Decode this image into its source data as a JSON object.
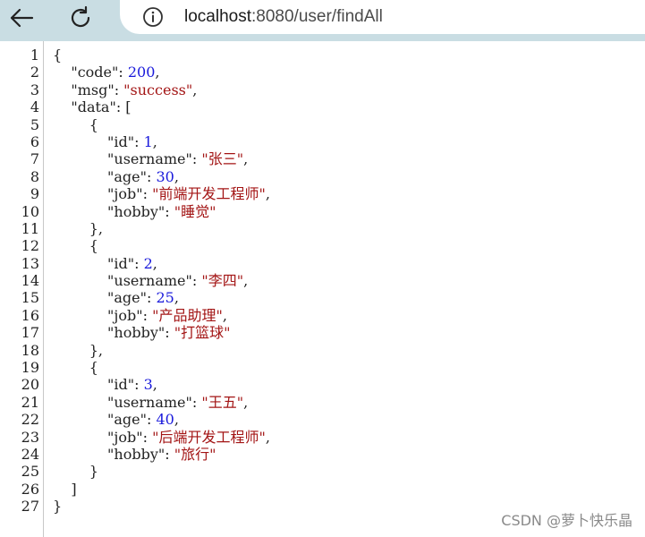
{
  "browser": {
    "url_host": "localhost",
    "url_rest": ":8080/user/findAll",
    "back_icon": "back-arrow-icon",
    "refresh_icon": "refresh-icon",
    "info_icon": "info-icon"
  },
  "response": {
    "code": 200,
    "msg": "success",
    "data": [
      {
        "id": 1,
        "username": "张三",
        "age": 30,
        "job": "前端开发工程师",
        "hobby": "睡觉"
      },
      {
        "id": 2,
        "username": "李四",
        "age": 25,
        "job": "产品助理",
        "hobby": "打篮球"
      },
      {
        "id": 3,
        "username": "王五",
        "age": 40,
        "job": "后端开发工程师",
        "hobby": "旅行"
      }
    ]
  },
  "line_numbers": [
    "1",
    "2",
    "3",
    "4",
    "5",
    "6",
    "7",
    "8",
    "9",
    "10",
    "11",
    "12",
    "13",
    "14",
    "15",
    "16",
    "17",
    "18",
    "19",
    "20",
    "21",
    "22",
    "23",
    "24",
    "25",
    "26",
    "27"
  ],
  "watermark": "CSDN @萝卜快乐晶",
  "colors": {
    "toolbar_bg": "#c9dde3",
    "number": "#1a1adb",
    "string": "#a31515",
    "text": "#222222"
  }
}
